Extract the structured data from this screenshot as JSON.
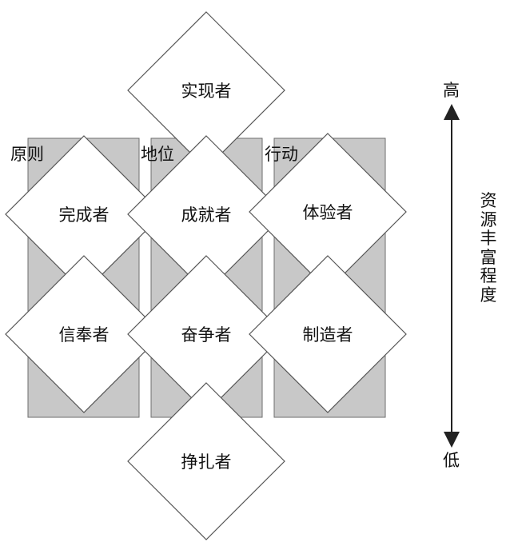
{
  "diagram": {
    "columns": [
      {
        "id": "principle",
        "label": "原则"
      },
      {
        "id": "status",
        "label": "地位"
      },
      {
        "id": "action",
        "label": "行动"
      }
    ],
    "nodes": [
      {
        "id": "actualizer",
        "label": "实现者"
      },
      {
        "id": "fulfilled",
        "label": "完成者"
      },
      {
        "id": "achiever",
        "label": "成就者"
      },
      {
        "id": "experiencer",
        "label": "体验者"
      },
      {
        "id": "believer",
        "label": "信奉者"
      },
      {
        "id": "striver",
        "label": "奋争者"
      },
      {
        "id": "maker",
        "label": "制造者"
      },
      {
        "id": "struggler",
        "label": "挣扎者"
      }
    ],
    "resource_scale": {
      "title": "资源丰富程度",
      "high": "高",
      "low": "低"
    }
  },
  "colors": {
    "panel_fill": "#c8c8c8",
    "panel_stroke": "#6e6e6e",
    "diamond_fill": "#ffffff",
    "diamond_stroke": "#555555",
    "text": "#111111"
  }
}
